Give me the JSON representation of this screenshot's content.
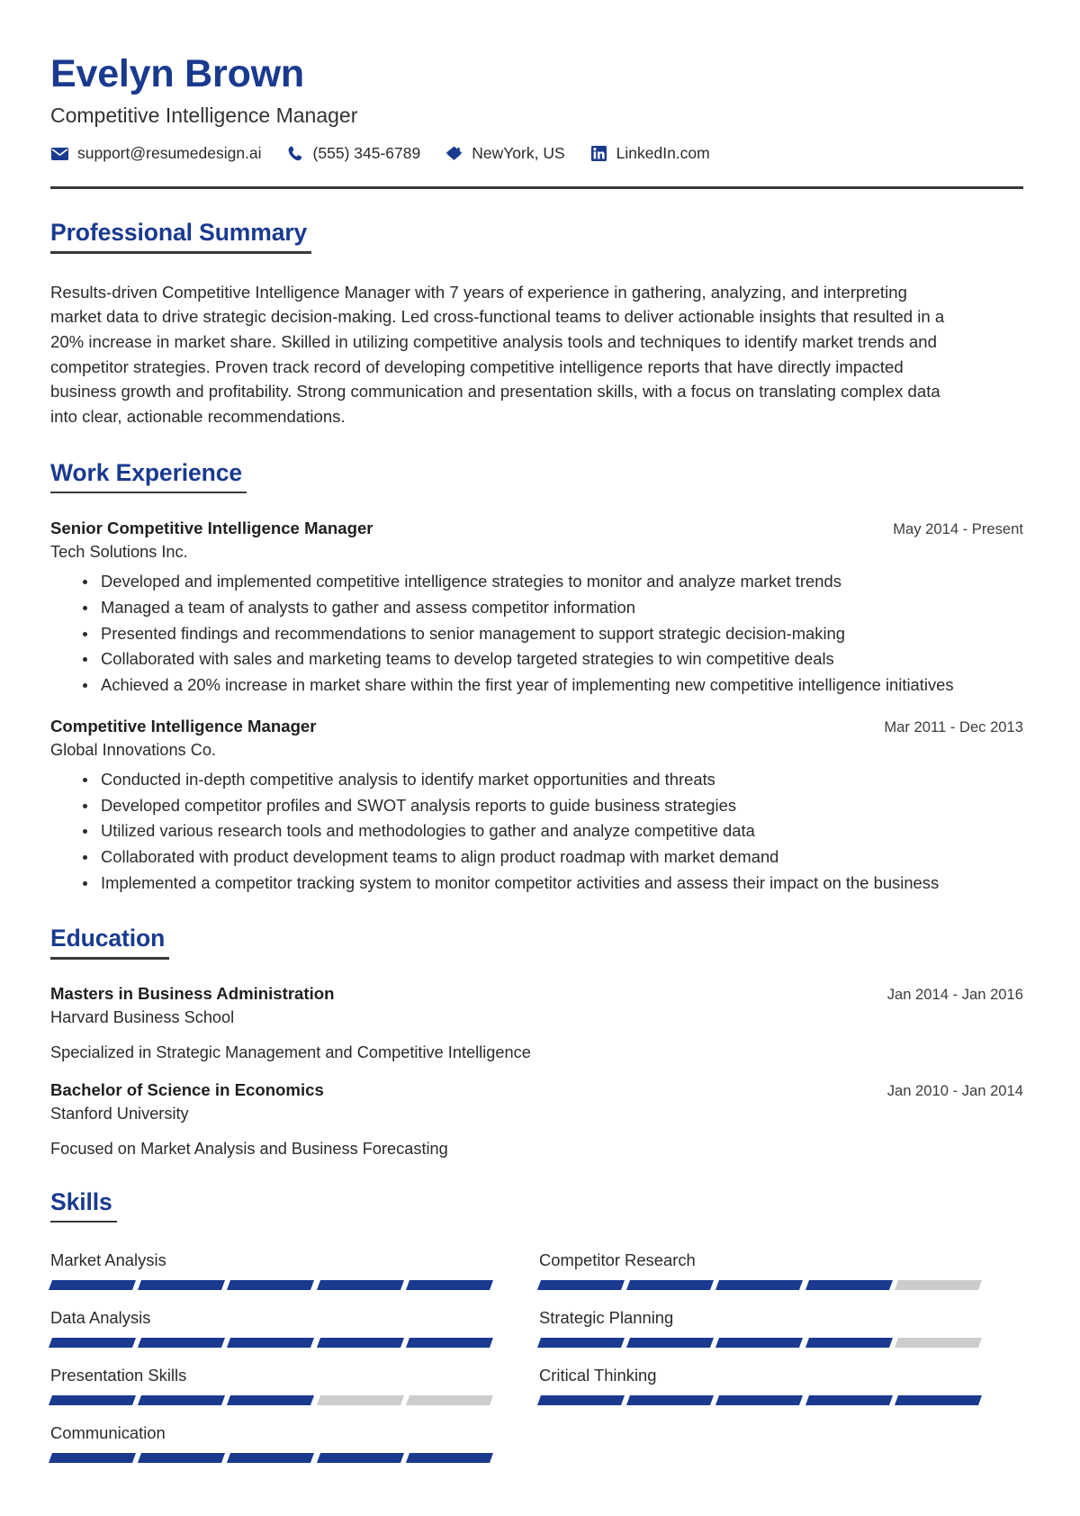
{
  "colors": {
    "accent": "#1a3a8f",
    "rule": "#3a3a3a",
    "text": "#2b2b2b",
    "bar_filled": "#1a3a8f",
    "bar_empty": "#cccccc"
  },
  "header": {
    "name": "Evelyn Brown",
    "job_title": "Competitive Intelligence Manager",
    "contacts": [
      {
        "icon": "envelope-icon",
        "value": "support@resumedesign.ai"
      },
      {
        "icon": "phone-icon",
        "value": "(555) 345-6789"
      },
      {
        "icon": "home-icon",
        "value": "NewYork, US"
      },
      {
        "icon": "linkedin-icon",
        "value": "LinkedIn.com"
      }
    ]
  },
  "summary": {
    "heading": "Professional Summary",
    "text": "Results-driven Competitive Intelligence Manager with 7 years of experience in gathering, analyzing, and interpreting market data to drive strategic decision-making. Led cross-functional teams to deliver actionable insights that resulted in a 20% increase in market share. Skilled in utilizing competitive analysis tools and techniques to identify market trends and competitor strategies. Proven track record of developing competitive intelligence reports that have directly impacted business growth and profitability. Strong communication and presentation skills, with a focus on translating complex data into clear, actionable recommendations."
  },
  "work": {
    "heading": "Work Experience",
    "entries": [
      {
        "role": "Senior Competitive Intelligence Manager",
        "company": "Tech Solutions Inc.",
        "date": "May 2014 - Present",
        "bullets": [
          "Developed and implemented competitive intelligence strategies to monitor and analyze market trends",
          "Managed a team of analysts to gather and assess competitor information",
          "Presented findings and recommendations to senior management to support strategic decision-making",
          "Collaborated with sales and marketing teams to develop targeted strategies to win competitive deals",
          "Achieved a 20% increase in market share within the first year of implementing new competitive intelligence initiatives"
        ]
      },
      {
        "role": "Competitive Intelligence Manager",
        "company": "Global Innovations Co.",
        "date": "Mar 2011 - Dec 2013",
        "bullets": [
          "Conducted in-depth competitive analysis to identify market opportunities and threats",
          "Developed competitor profiles and SWOT analysis reports to guide business strategies",
          "Utilized various research tools and methodologies to gather and analyze competitive data",
          "Collaborated with product development teams to align product roadmap with market demand",
          "Implemented a competitor tracking system to monitor competitor activities and assess their impact on the business"
        ]
      }
    ]
  },
  "education": {
    "heading": "Education",
    "entries": [
      {
        "degree": "Masters in Business Administration",
        "school": "Harvard Business School",
        "date": "Jan 2014 - Jan 2016",
        "note": "Specialized in Strategic Management and Competitive Intelligence"
      },
      {
        "degree": "Bachelor of Science in Economics",
        "school": "Stanford University",
        "date": "Jan 2010 - Jan 2014",
        "note": "Focused on Market Analysis and Business Forecasting"
      }
    ]
  },
  "skills": {
    "heading": "Skills",
    "max_level": 5,
    "items": [
      {
        "name": "Market Analysis",
        "level": 5
      },
      {
        "name": "Competitor Research",
        "level": 4
      },
      {
        "name": "Data Analysis",
        "level": 5
      },
      {
        "name": "Strategic Planning",
        "level": 4
      },
      {
        "name": "Presentation Skills",
        "level": 3
      },
      {
        "name": "Critical Thinking",
        "level": 5
      },
      {
        "name": "Communication",
        "level": 5
      }
    ]
  }
}
